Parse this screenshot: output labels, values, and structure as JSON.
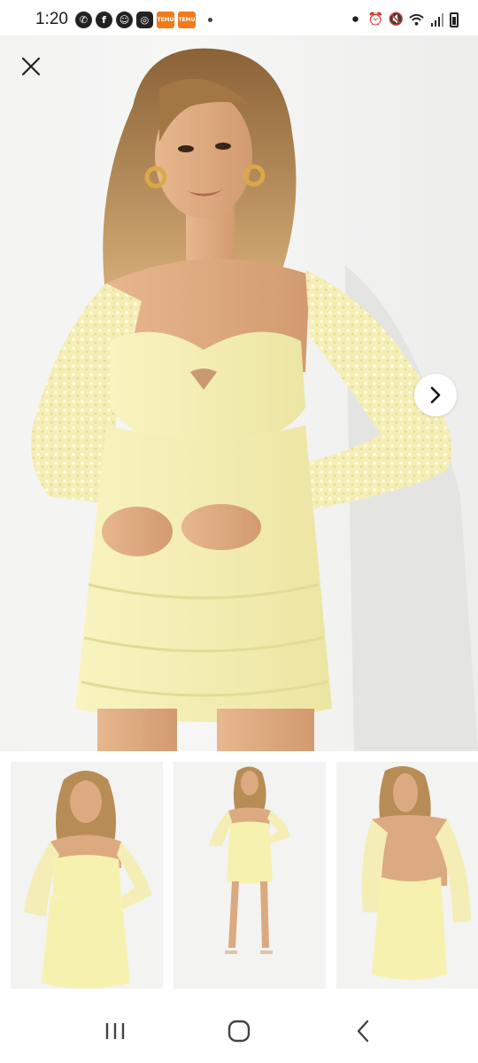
{
  "status_bar": {
    "time": "1:20",
    "left_icons": [
      "whatsapp-icon",
      "facebook-icon",
      "snapchat-icon",
      "instagram-icon",
      "temu-icon",
      "temu-icon"
    ],
    "temu_label": "TEMU",
    "right_icons": [
      "recording-icon",
      "alarm-icon",
      "mute-icon",
      "wifi-icon",
      "signal-icon",
      "battery-icon"
    ]
  },
  "product_gallery": {
    "main_image_alt": "model wearing pale yellow long-sleeve mesh mini dress",
    "dress_color": "#f7f1b0",
    "thumbnails": [
      {
        "name": "front-closeup"
      },
      {
        "name": "full-length"
      },
      {
        "name": "back-view"
      }
    ]
  },
  "nav": {
    "buttons": [
      "recent-apps",
      "home",
      "back"
    ]
  }
}
